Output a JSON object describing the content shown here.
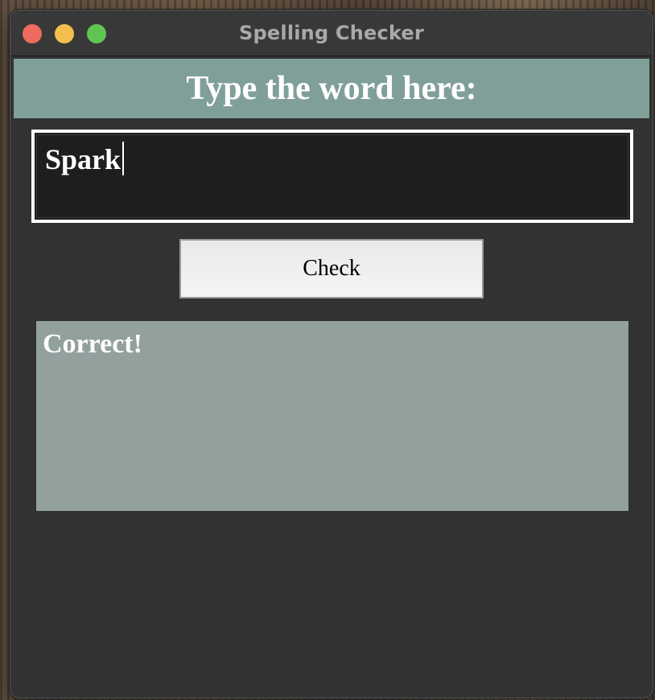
{
  "window": {
    "title": "Spelling Checker"
  },
  "header": {
    "prompt": "Type the word here:"
  },
  "input": {
    "value": "Spark"
  },
  "button": {
    "label": "Check"
  },
  "result": {
    "text": "Correct!"
  },
  "colors": {
    "header_bg": "#809f99",
    "result_bg": "#92a09e",
    "window_bg": "#323232",
    "close": "#ec6a5e",
    "minimize": "#f4bf4f",
    "maximize": "#61c554"
  }
}
